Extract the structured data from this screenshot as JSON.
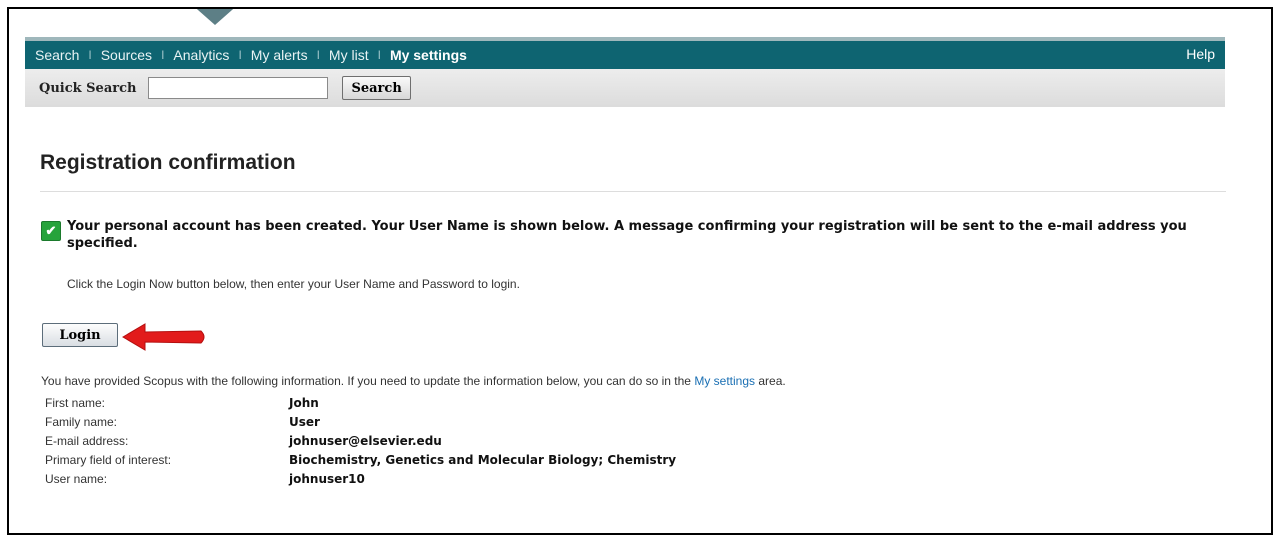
{
  "nav": {
    "items": [
      {
        "label": "Search"
      },
      {
        "label": "Sources"
      },
      {
        "label": "Analytics"
      },
      {
        "label": "My alerts"
      },
      {
        "label": "My list"
      },
      {
        "label": "My settings"
      }
    ],
    "separator": "I",
    "help": "Help"
  },
  "quick_search": {
    "label": "Quick Search",
    "value": "",
    "button": "Search"
  },
  "page": {
    "title": "Registration confirmation",
    "confirmation": "Your personal account has been created. Your User Name is shown below. A message confirming your registration will be sent to the e-mail address you specified.",
    "instruction": "Click the Login Now button below, then enter your User Name and Password to login.",
    "login_button": "Login",
    "provided_prefix": "You have provided Scopus with the following information. If you need to update the information below, you can do so in the",
    "provided_link": "My settings",
    "provided_suffix": "area."
  },
  "info": {
    "rows": [
      {
        "label": "First name:",
        "value": "John"
      },
      {
        "label": "Family name:",
        "value": "User"
      },
      {
        "label": "E-mail address:",
        "value": "johnuser@elsevier.edu"
      },
      {
        "label": "Primary field of interest:",
        "value": "Biochemistry, Genetics and Molecular Biology; Chemistry"
      },
      {
        "label": "User name:",
        "value": "johnuser10"
      }
    ]
  },
  "colors": {
    "navbar": "#0e6471",
    "success": "#26a33b",
    "link": "#1a6fb3",
    "arrow": "#e21b1b"
  },
  "icons": {
    "success": "check-icon",
    "annotation": "red-arrow-icon"
  }
}
